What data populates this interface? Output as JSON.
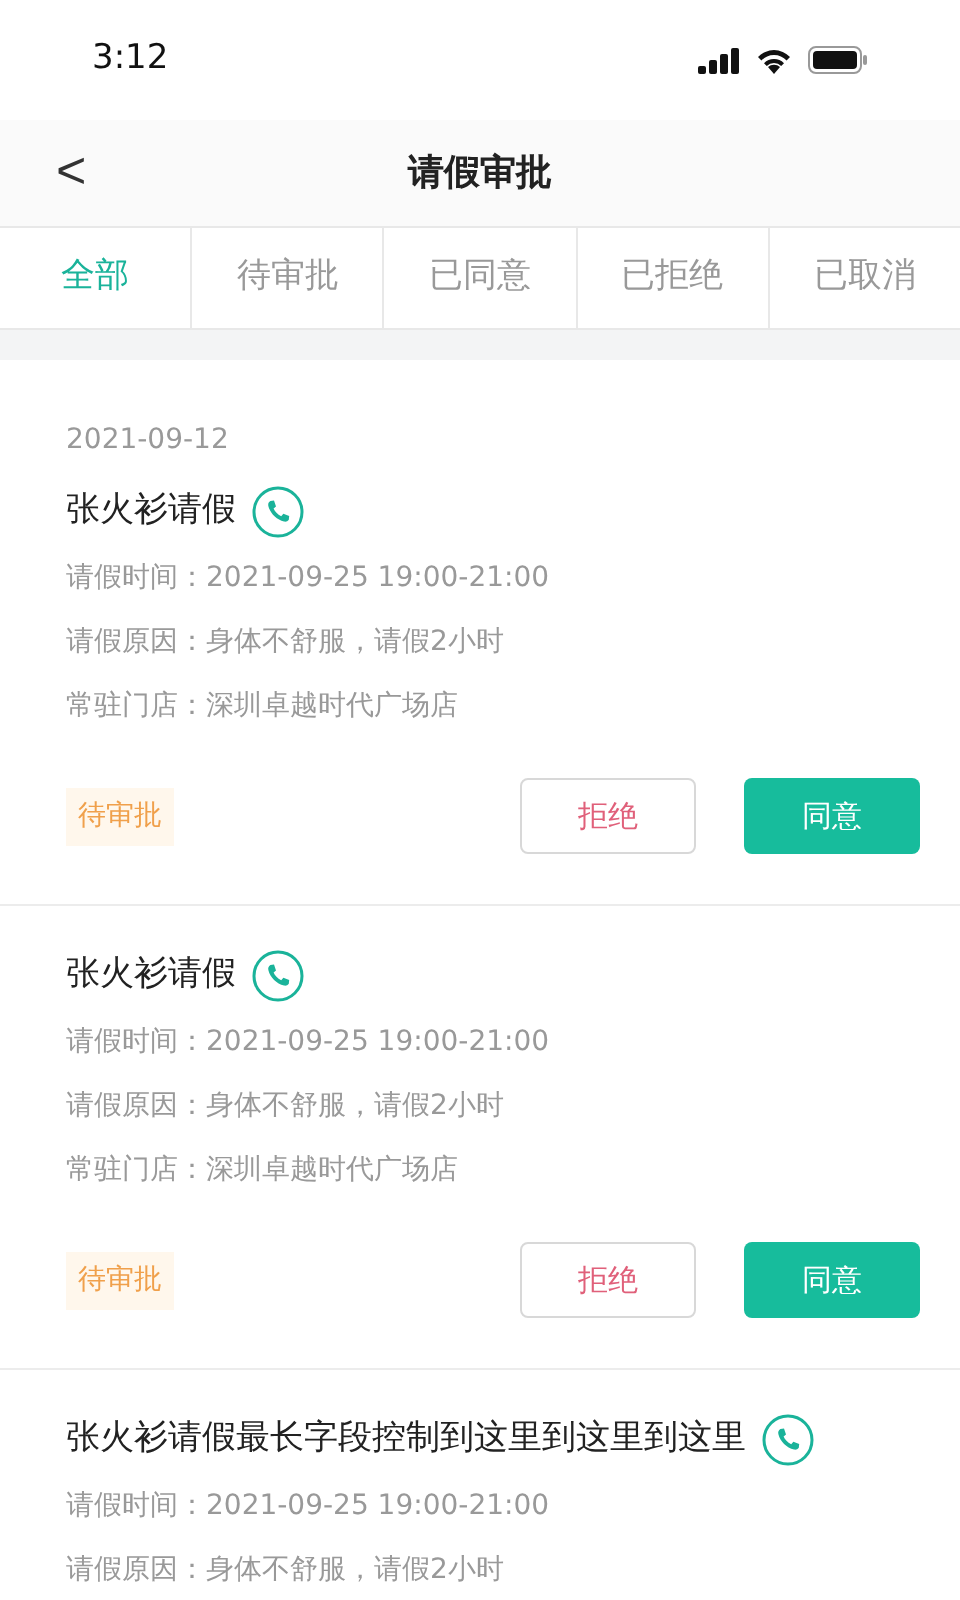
{
  "status_bar": {
    "time": "3:12"
  },
  "nav": {
    "back": "<",
    "title": "请假审批"
  },
  "tabs": [
    {
      "label": "全部",
      "selected": true
    },
    {
      "label": "待审批",
      "selected": false
    },
    {
      "label": "已同意",
      "selected": false
    },
    {
      "label": "已拒绝",
      "selected": false
    },
    {
      "label": "已取消",
      "selected": false
    }
  ],
  "requests": [
    {
      "date": "2021-09-12",
      "name": "张火衫请假",
      "lines": [
        "请假时间：2021-09-25 19:00-21:00",
        "请假原因：身体不舒服，请假2小时",
        "常驻门店：深圳卓越时代广场店"
      ],
      "status": "待审批",
      "reject": "拒绝",
      "approve": "同意"
    },
    {
      "name": "张火衫请假",
      "lines": [
        "请假时间：2021-09-25 19:00-21:00",
        "请假原因：身体不舒服，请假2小时",
        "常驻门店：深圳卓越时代广场店"
      ],
      "status": "待审批",
      "reject": "拒绝",
      "approve": "同意"
    },
    {
      "name": "张火衫请假最长字段控制到这里到这里到这里",
      "lines": [
        "请假时间：2021-09-25 19:00-21:00",
        "请假原因：身体不舒服，请假2小时"
      ]
    }
  ]
}
